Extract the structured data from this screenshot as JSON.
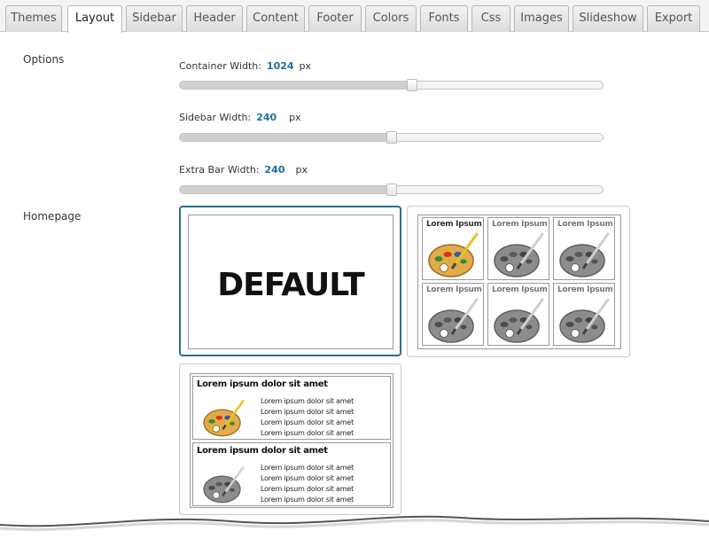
{
  "tabs": [
    {
      "label": "Themes",
      "active": false
    },
    {
      "label": "Layout",
      "active": true
    },
    {
      "label": "Sidebar",
      "active": false
    },
    {
      "label": "Header",
      "active": false
    },
    {
      "label": "Content",
      "active": false
    },
    {
      "label": "Footer",
      "active": false
    },
    {
      "label": "Colors",
      "active": false
    },
    {
      "label": "Fonts",
      "active": false
    },
    {
      "label": "Css",
      "active": false
    },
    {
      "label": "Images",
      "active": false
    },
    {
      "label": "Slideshow",
      "active": false
    },
    {
      "label": "Export",
      "active": false
    }
  ],
  "options": {
    "section_label": "Options",
    "container_width": {
      "label": "Container Width:",
      "value": "1024",
      "unit": "px",
      "fraction": 0.55
    },
    "sidebar_width": {
      "label": "Sidebar Width:",
      "value": "240",
      "unit": "px",
      "fraction": 0.5
    },
    "extra_bar_width": {
      "label": "Extra Bar Width:",
      "value": "240",
      "unit": "px",
      "fraction": 0.5
    }
  },
  "homepage": {
    "section_label": "Homepage",
    "default_layout": {
      "label": "DEFAULT",
      "selected": true
    },
    "grid_layout": {
      "cells": [
        {
          "title": "Lorem Ipsum",
          "icon": "palette-color-icon"
        },
        {
          "title": "Lorem Ipsum",
          "icon": "palette-gray-icon"
        },
        {
          "title": "Lorem Ipsum",
          "icon": "palette-gray-icon"
        },
        {
          "title": "Lorem Ipsum",
          "icon": "palette-gray-icon"
        },
        {
          "title": "Lorem Ipsum",
          "icon": "palette-gray-icon"
        },
        {
          "title": "Lorem Ipsum",
          "icon": "palette-gray-icon"
        }
      ]
    },
    "list_layout": {
      "rows": [
        {
          "title": "Lorem ipsum dolor sit amet",
          "icon": "palette-color-icon",
          "lines": [
            "Lorem ipsum dolor sit amet",
            "Lorem ipsum dolor sit amet",
            "Lorem ipsum dolor sit amet",
            "Lorem ipsum dolor sit amet"
          ]
        },
        {
          "title": "Lorem ipsum dolor sit amet",
          "icon": "palette-gray-icon",
          "lines": [
            "Lorem ipsum dolor sit amet",
            "Lorem ipsum dolor sit amet",
            "Lorem ipsum dolor sit amet",
            "Lorem ipsum dolor sit amet"
          ]
        }
      ]
    }
  },
  "colors": {
    "accent": "#1f6f9c",
    "selected_border": "#2a6f8f"
  }
}
